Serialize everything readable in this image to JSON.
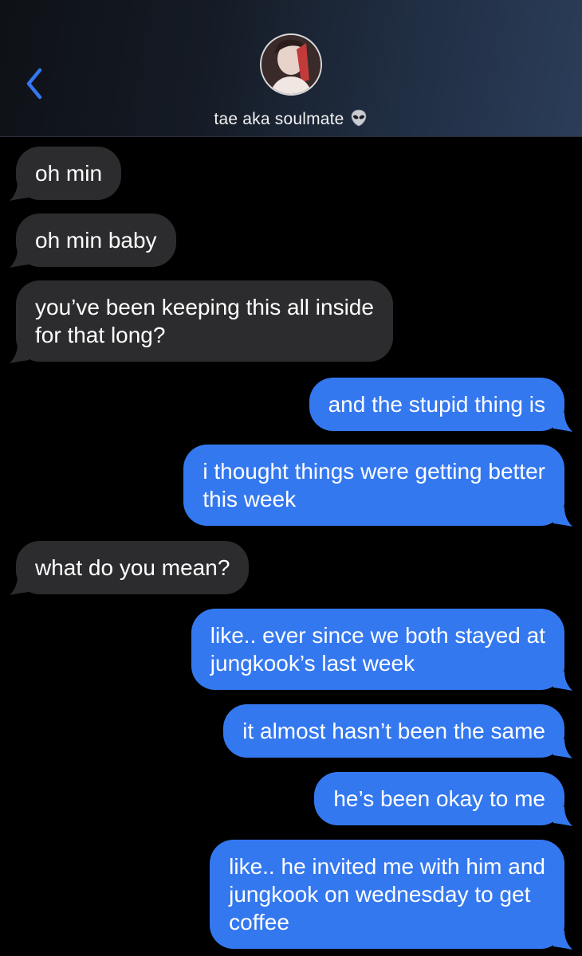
{
  "header": {
    "contact_name": "tae aka soulmate",
    "contact_emoji_icon": "alien-icon",
    "back_icon": "chevron-left-icon",
    "accent_color": "#3478f0"
  },
  "messages": [
    {
      "direction": "incoming",
      "text": "oh min"
    },
    {
      "direction": "incoming",
      "text": "oh min baby"
    },
    {
      "direction": "incoming",
      "text": "you’ve been keeping this all inside\nfor that long?"
    },
    {
      "direction": "outgoing",
      "text": "and the stupid thing is"
    },
    {
      "direction": "outgoing",
      "text": "i thought things were getting better\nthis week"
    },
    {
      "direction": "incoming",
      "text": "what do you mean?"
    },
    {
      "direction": "outgoing",
      "text": "like.. ever since we both stayed at\njungkook’s last week"
    },
    {
      "direction": "outgoing",
      "text": "it almost hasn’t been the same"
    },
    {
      "direction": "outgoing",
      "text": "he’s been okay to me"
    },
    {
      "direction": "outgoing",
      "text": "like.. he invited me with him and\njungkook on wednesday to get\ncoffee"
    }
  ],
  "colors": {
    "incoming_bubble": "#2c2c2e",
    "outgoing_bubble": "#3478f0",
    "background": "#000000"
  }
}
